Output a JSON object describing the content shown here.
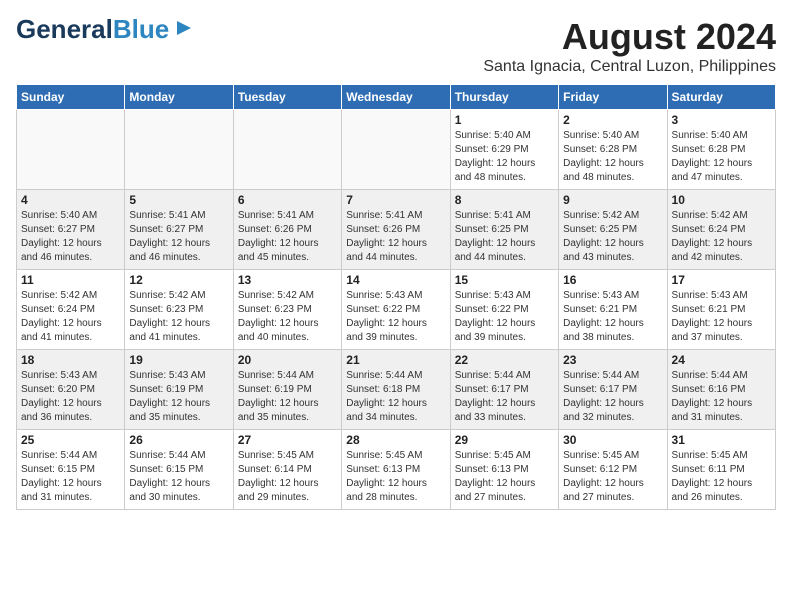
{
  "header": {
    "logo_general": "General",
    "logo_blue": "Blue",
    "title": "August 2024",
    "location": "Santa Ignacia, Central Luzon, Philippines"
  },
  "days_of_week": [
    "Sunday",
    "Monday",
    "Tuesday",
    "Wednesday",
    "Thursday",
    "Friday",
    "Saturday"
  ],
  "weeks": [
    [
      {
        "day": "",
        "info": ""
      },
      {
        "day": "",
        "info": ""
      },
      {
        "day": "",
        "info": ""
      },
      {
        "day": "",
        "info": ""
      },
      {
        "day": "1",
        "info": "Sunrise: 5:40 AM\nSunset: 6:29 PM\nDaylight: 12 hours\nand 48 minutes."
      },
      {
        "day": "2",
        "info": "Sunrise: 5:40 AM\nSunset: 6:28 PM\nDaylight: 12 hours\nand 48 minutes."
      },
      {
        "day": "3",
        "info": "Sunrise: 5:40 AM\nSunset: 6:28 PM\nDaylight: 12 hours\nand 47 minutes."
      }
    ],
    [
      {
        "day": "4",
        "info": "Sunrise: 5:40 AM\nSunset: 6:27 PM\nDaylight: 12 hours\nand 46 minutes."
      },
      {
        "day": "5",
        "info": "Sunrise: 5:41 AM\nSunset: 6:27 PM\nDaylight: 12 hours\nand 46 minutes."
      },
      {
        "day": "6",
        "info": "Sunrise: 5:41 AM\nSunset: 6:26 PM\nDaylight: 12 hours\nand 45 minutes."
      },
      {
        "day": "7",
        "info": "Sunrise: 5:41 AM\nSunset: 6:26 PM\nDaylight: 12 hours\nand 44 minutes."
      },
      {
        "day": "8",
        "info": "Sunrise: 5:41 AM\nSunset: 6:25 PM\nDaylight: 12 hours\nand 44 minutes."
      },
      {
        "day": "9",
        "info": "Sunrise: 5:42 AM\nSunset: 6:25 PM\nDaylight: 12 hours\nand 43 minutes."
      },
      {
        "day": "10",
        "info": "Sunrise: 5:42 AM\nSunset: 6:24 PM\nDaylight: 12 hours\nand 42 minutes."
      }
    ],
    [
      {
        "day": "11",
        "info": "Sunrise: 5:42 AM\nSunset: 6:24 PM\nDaylight: 12 hours\nand 41 minutes."
      },
      {
        "day": "12",
        "info": "Sunrise: 5:42 AM\nSunset: 6:23 PM\nDaylight: 12 hours\nand 41 minutes."
      },
      {
        "day": "13",
        "info": "Sunrise: 5:42 AM\nSunset: 6:23 PM\nDaylight: 12 hours\nand 40 minutes."
      },
      {
        "day": "14",
        "info": "Sunrise: 5:43 AM\nSunset: 6:22 PM\nDaylight: 12 hours\nand 39 minutes."
      },
      {
        "day": "15",
        "info": "Sunrise: 5:43 AM\nSunset: 6:22 PM\nDaylight: 12 hours\nand 39 minutes."
      },
      {
        "day": "16",
        "info": "Sunrise: 5:43 AM\nSunset: 6:21 PM\nDaylight: 12 hours\nand 38 minutes."
      },
      {
        "day": "17",
        "info": "Sunrise: 5:43 AM\nSunset: 6:21 PM\nDaylight: 12 hours\nand 37 minutes."
      }
    ],
    [
      {
        "day": "18",
        "info": "Sunrise: 5:43 AM\nSunset: 6:20 PM\nDaylight: 12 hours\nand 36 minutes."
      },
      {
        "day": "19",
        "info": "Sunrise: 5:43 AM\nSunset: 6:19 PM\nDaylight: 12 hours\nand 35 minutes."
      },
      {
        "day": "20",
        "info": "Sunrise: 5:44 AM\nSunset: 6:19 PM\nDaylight: 12 hours\nand 35 minutes."
      },
      {
        "day": "21",
        "info": "Sunrise: 5:44 AM\nSunset: 6:18 PM\nDaylight: 12 hours\nand 34 minutes."
      },
      {
        "day": "22",
        "info": "Sunrise: 5:44 AM\nSunset: 6:17 PM\nDaylight: 12 hours\nand 33 minutes."
      },
      {
        "day": "23",
        "info": "Sunrise: 5:44 AM\nSunset: 6:17 PM\nDaylight: 12 hours\nand 32 minutes."
      },
      {
        "day": "24",
        "info": "Sunrise: 5:44 AM\nSunset: 6:16 PM\nDaylight: 12 hours\nand 31 minutes."
      }
    ],
    [
      {
        "day": "25",
        "info": "Sunrise: 5:44 AM\nSunset: 6:15 PM\nDaylight: 12 hours\nand 31 minutes."
      },
      {
        "day": "26",
        "info": "Sunrise: 5:44 AM\nSunset: 6:15 PM\nDaylight: 12 hours\nand 30 minutes."
      },
      {
        "day": "27",
        "info": "Sunrise: 5:45 AM\nSunset: 6:14 PM\nDaylight: 12 hours\nand 29 minutes."
      },
      {
        "day": "28",
        "info": "Sunrise: 5:45 AM\nSunset: 6:13 PM\nDaylight: 12 hours\nand 28 minutes."
      },
      {
        "day": "29",
        "info": "Sunrise: 5:45 AM\nSunset: 6:13 PM\nDaylight: 12 hours\nand 27 minutes."
      },
      {
        "day": "30",
        "info": "Sunrise: 5:45 AM\nSunset: 6:12 PM\nDaylight: 12 hours\nand 27 minutes."
      },
      {
        "day": "31",
        "info": "Sunrise: 5:45 AM\nSunset: 6:11 PM\nDaylight: 12 hours\nand 26 minutes."
      }
    ]
  ]
}
